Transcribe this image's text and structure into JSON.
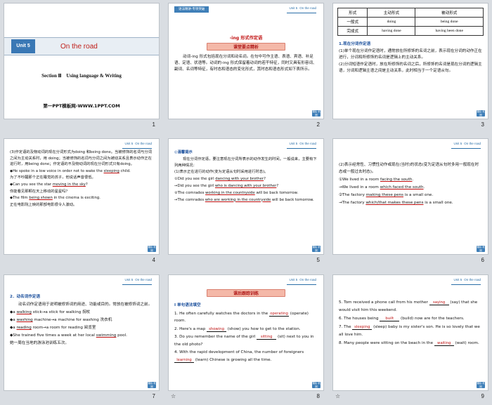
{
  "slides": {
    "s1": {
      "unit": "Unit 5",
      "title": "On the road",
      "section": "Section Ⅲ　Using language & Writing",
      "ppt": "第一PPT模板网-WWW.1PPT.COM",
      "num": "1"
    },
    "header": {
      "unit": "Unit 5",
      "topic": "On the road"
    },
    "back": "课后\n巩固",
    "s2": {
      "tag": "语法精讲·专项突破",
      "title": "-ing 形式作定语",
      "banner": "课堂要点精析",
      "text": "动词-ing 形式包括现在分词和动名词。在句中可作主语、表语、宾语、补足语、定语、状语等。动词的-ing 形式保留着动词的若干特征，同时又具有形容词、副词、名词等特征，有时态和语态的变化形式，其时态和语态形式如下表所示。",
      "num": "2"
    },
    "s3": {
      "headers": [
        "形式",
        "主动形式",
        "被动形式"
      ],
      "rows": [
        [
          "一般式",
          "doing",
          "being done"
        ],
        [
          "完成式",
          "having done",
          "having been done"
        ]
      ],
      "sec": "1.现在分词作定语",
      "p1": "(1)单个现在分词作定语时，通常放在所修饰的名词之前，表示现在分词的动作正在进行，分词和所修饰的名词是逻辑上的主动关系。",
      "p2": "(2)分词短语作定语时，放在所修饰的名词之后，所修饰的名词是现在分词的逻辑主语，分词和逻辑主语之间是主动关系，此时相当于一个定语从句。",
      "num": "3"
    },
    "s4": {
      "p1": "(3)作定语的及物动词的现在分词形式为doing 和being done。当被修饰的名词与分词之间为主动关系时，用 doing；当被修饰的名词与分词之间为被动关系且表示动作正在进行时，用being done；作定语的不及物动词的现在分词形式只有doing。",
      "e1a": "◆He spoke in a low voice in order not to wake the ",
      "e1u": "sleeping",
      "e1b": " child.",
      "e1c": "为了不吵醒那个正在睡觉的孩子，他说话声音很低。",
      "e2a": "◆Can you see the star ",
      "e2u": "moving in the sky",
      "e2b": "?",
      "e2c": "你能看见那颗在天上移动的星星吗？",
      "e3a": "◆The film ",
      "e3u": "being shown",
      "e3b": " in the cinema is exciting.",
      "e3c": "正在电影院上映的那部电影很令人激动。",
      "num": "4"
    },
    "s5": {
      "label": "◎温馨提示",
      "p1": "现在分词作定语，要注意现在分词所表示的动作发生的时间。一般说来，主要有下列两种情况：",
      "p2": "(1)表示正在进行的动作(变为定语从句时采用进行时态)。",
      "e1a": "①Did you see the girl ",
      "e1u": "dancing with your brother",
      "e1b": "?",
      "e2a": "→Did you see the girl ",
      "e2u": "who is dancing with your brother",
      "e2b": "?",
      "e3a": "②The comrades ",
      "e3u": "working in the countryside",
      "e3b": " will be back tomorrow.",
      "e4a": "→The comrades ",
      "e4u": "who are working in the countryside",
      "e4b": " will be back tomorrow.",
      "num": "5"
    },
    "s6": {
      "p1": "(2)表示经常性、习惯性动作或现在(当时)的状态(变为定语从句时多用一般现在时态或一般过去时态)。",
      "e1a": "①We lived in a room ",
      "e1u": "facing the south",
      "e1b": ".",
      "e2a": "→We lived in a room ",
      "e2u": "which faced the south",
      "e2b": ".",
      "e3a": "②The factory ",
      "e3u": "making these pens",
      "e3b": " is a small one.",
      "e4a": "→The factory ",
      "e4u": "which/that makes these pens",
      "e4b": " is a small one.",
      "num": "6"
    },
    "s7": {
      "sec": "2．动名词作定语",
      "p1": "动名词作定语用于说明被修饰词的用途、功能或目的。常放在被修饰词之前。",
      "e1a": "◆a ",
      "e1u": "walking",
      "e1b": " stick→a stick for walking  拐杖",
      "e2a": "◆a ",
      "e2u": "washing",
      "e2b": " machine→a machine for washing  洗衣机",
      "e3a": "◆a ",
      "e3u": "reading",
      "e3b": " room→a room for reading  阅览室",
      "e4a": "◆She trained five times a week at her local ",
      "e4u": "swimming",
      "e4b": " pool.",
      "e4c": "她一周在当地的游泳池训练五次。",
      "num": "7"
    },
    "s8": {
      "banner": "课后跟踪训练",
      "sec": "Ⅰ 单句语法填空",
      "q1a": "1. He often carefully watches the doctors in the ",
      "q1ans": "operating",
      "q1b": " (operate) room.",
      "q2a": "2. Here's a map ",
      "q2ans": "showing",
      "q2b": " (show) you how to get to the station.",
      "q3a": "3. Do you remember the name of the girl ",
      "q3ans": "sitting",
      "q3b": " (sit) next to you in the old photo?",
      "q4a": "4. With the rapid development of China, the number of foreigners ",
      "q4ans": "learning",
      "q4b": " (learn) Chinese is growing all the time.",
      "num": "8"
    },
    "s9": {
      "q5a": "5. Tom received a phone call from his mother ",
      "q5ans": "saying",
      "q5b": " (say) that she would visit him this weekend.",
      "q6a": "6. The houses being ",
      "q6ans": "built",
      "q6b": " (build) now are for the teachers.",
      "q7a": "7. The ",
      "q7ans": "sleeping",
      "q7b": " (sleep) baby is my sister's son. He is so lovely that we all love him.",
      "q8a": "8. Many people were sitting on the beach in the ",
      "q8ans": "waiting",
      "q8b": " (wait) room.",
      "num": "9"
    }
  }
}
